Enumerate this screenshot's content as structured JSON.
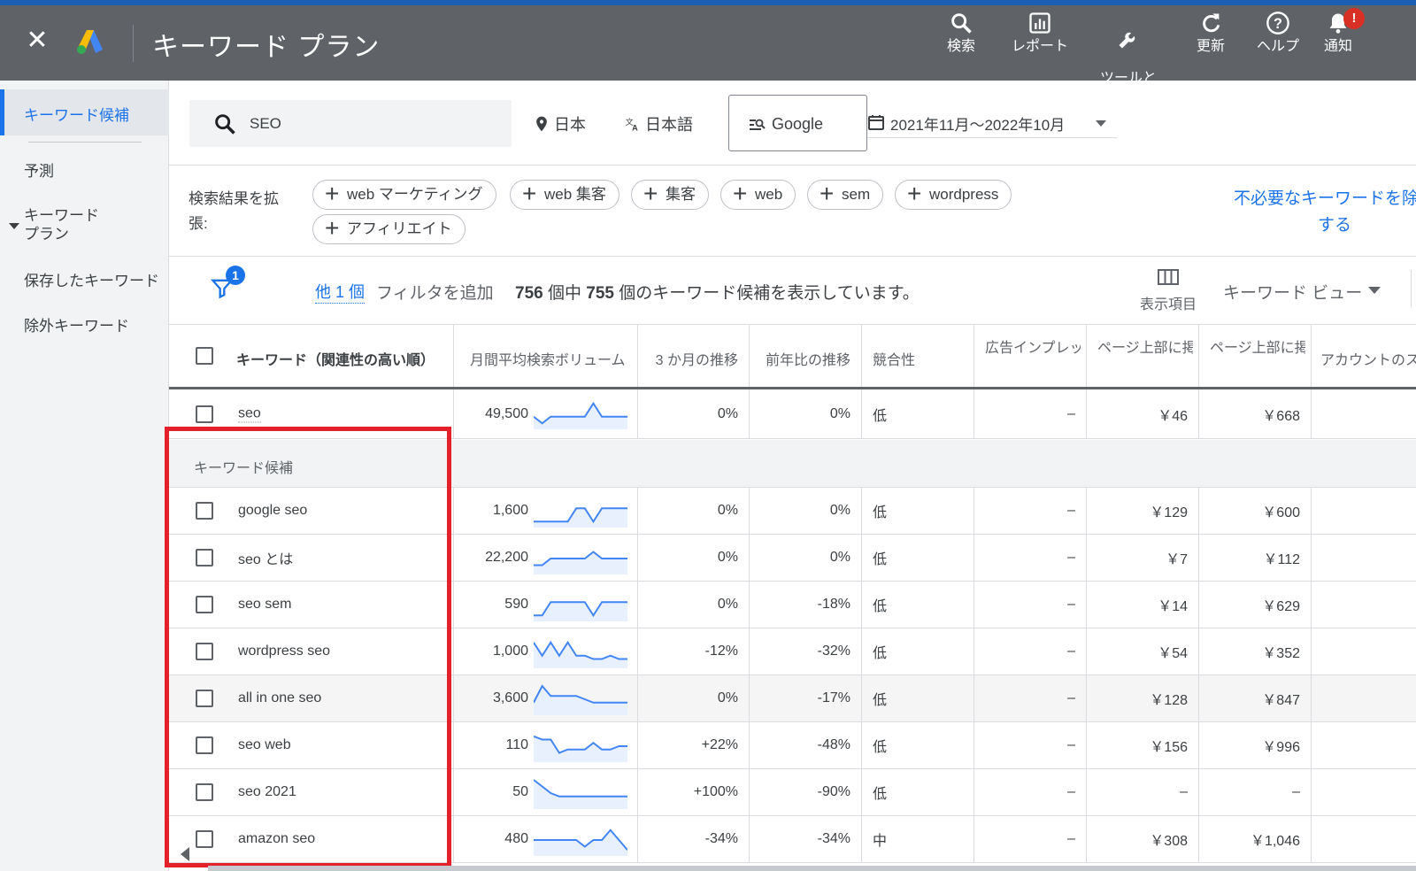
{
  "header": {
    "title": "キーワード プラン",
    "actions": [
      {
        "label": "検索",
        "icon": "search-icon"
      },
      {
        "label": "レポート",
        "icon": "report-icon"
      },
      {
        "label": "ツールと\n設定",
        "icon": "wrench-icon"
      },
      {
        "label": "更新",
        "icon": "refresh-icon"
      },
      {
        "label": "ヘルプ",
        "icon": "help-icon"
      },
      {
        "label": "通知",
        "icon": "bell-icon"
      }
    ],
    "notification_badge": "!",
    "colors": {
      "bar": "#5f6368",
      "top_line": "#1a5fb4",
      "badge": "#d93025"
    }
  },
  "sidebar": {
    "items": [
      {
        "label": "キーワード候補",
        "active": true
      },
      {
        "label": "予測"
      },
      {
        "label": "キーワード\nプラン",
        "expandable": true
      },
      {
        "label": "保存したキーワード"
      },
      {
        "label": "除外キーワード"
      }
    ]
  },
  "search": {
    "value": "SEO",
    "location": "日本",
    "language": "日本語",
    "network": "Google",
    "date_range": "2021年11月～2022年10月"
  },
  "expand": {
    "label": "検索結果を拡張:",
    "chips": [
      "web マーケティング",
      "web 集客",
      "集客",
      "web",
      "sem",
      "wordpress",
      "アフィリエイト"
    ],
    "remove_link": "不必要なキーワードを除外する"
  },
  "filter": {
    "badge": "1",
    "other": "他 1 個",
    "add": "フィルタを追加",
    "total": "756",
    "shown": "755",
    "count_prefix": "個中",
    "count_suffix": "個のキーワード候補を表示しています。",
    "columns_label": "表示項目",
    "view_label": "キーワード ビュー"
  },
  "table": {
    "columns": [
      "キーワード（関連性の高い順）",
      "月間平均検索ボリューム",
      "3 か月の推移",
      "前年比の推移",
      "競合性",
      "広告インプレッション",
      "ページ上部に掲載",
      "ページ上部に掲載",
      "アカウントのステータス"
    ],
    "main_row": {
      "keyword": "seo",
      "volume": "49,500",
      "trend": [
        3,
        1,
        3,
        3,
        3,
        3,
        3,
        7,
        3,
        3,
        3,
        3
      ],
      "m3": "0%",
      "yoy": "0%",
      "comp": "低",
      "impr": "–",
      "low_bid": "￥46",
      "high_bid": "￥668"
    },
    "group_label": "キーワード候補",
    "rows": [
      {
        "keyword": "google seo",
        "volume": "1,600",
        "trend": [
          1,
          1,
          1,
          1,
          1,
          5,
          5,
          1,
          5,
          5,
          5,
          5
        ],
        "m3": "0%",
        "yoy": "0%",
        "comp": "低",
        "impr": "–",
        "low_bid": "￥129",
        "high_bid": "￥600"
      },
      {
        "keyword": "seo とは",
        "volume": "22,200",
        "trend": [
          2,
          2,
          4,
          4,
          4,
          4,
          4,
          6,
          4,
          4,
          4,
          4
        ],
        "m3": "0%",
        "yoy": "0%",
        "comp": "低",
        "impr": "–",
        "low_bid": "￥7",
        "high_bid": "￥112"
      },
      {
        "keyword": "seo sem",
        "volume": "590",
        "trend": [
          1,
          1,
          5,
          5,
          5,
          5,
          5,
          1,
          5,
          5,
          5,
          5
        ],
        "m3": "0%",
        "yoy": "-18%",
        "comp": "低",
        "impr": "–",
        "low_bid": "￥14",
        "high_bid": "￥629"
      },
      {
        "keyword": "wordpress seo",
        "volume": "1,000",
        "trend": [
          7,
          3,
          7,
          3,
          7,
          3,
          3,
          2,
          2,
          3,
          2,
          2
        ],
        "m3": "-12%",
        "yoy": "-32%",
        "comp": "低",
        "impr": "–",
        "low_bid": "￥54",
        "high_bid": "￥352"
      },
      {
        "keyword": "all in one seo",
        "volume": "3,600",
        "trend": [
          3,
          8,
          5,
          5,
          5,
          5,
          4,
          3,
          3,
          3,
          3,
          3
        ],
        "m3": "0%",
        "yoy": "-17%",
        "comp": "低",
        "impr": "–",
        "low_bid": "￥128",
        "high_bid": "￥847",
        "highlight": true
      },
      {
        "keyword": "seo web",
        "volume": "110",
        "trend": [
          7,
          6,
          6,
          2,
          3,
          3,
          3,
          5,
          3,
          3,
          4,
          4
        ],
        "m3": "+22%",
        "yoy": "-48%",
        "comp": "低",
        "impr": "–",
        "low_bid": "￥156",
        "high_bid": "￥996"
      },
      {
        "keyword": "seo 2021",
        "volume": "50",
        "trend": [
          8,
          6,
          4,
          3,
          3,
          3,
          3,
          3,
          3,
          3,
          3,
          3
        ],
        "m3": "+100%",
        "yoy": "-90%",
        "comp": "低",
        "impr": "–",
        "low_bid": "–",
        "high_bid": "–"
      },
      {
        "keyword": "amazon seo",
        "volume": "480",
        "trend": [
          4,
          4,
          4,
          4,
          4,
          4,
          2,
          4,
          4,
          7,
          4,
          1
        ],
        "m3": "-34%",
        "yoy": "-34%",
        "comp": "中",
        "impr": "–",
        "low_bid": "￥308",
        "high_bid": "￥1,046"
      }
    ],
    "trend_color": "#4285f4",
    "trend_fill": "#e8f0fe",
    "highlight_color": "#e4202a"
  }
}
